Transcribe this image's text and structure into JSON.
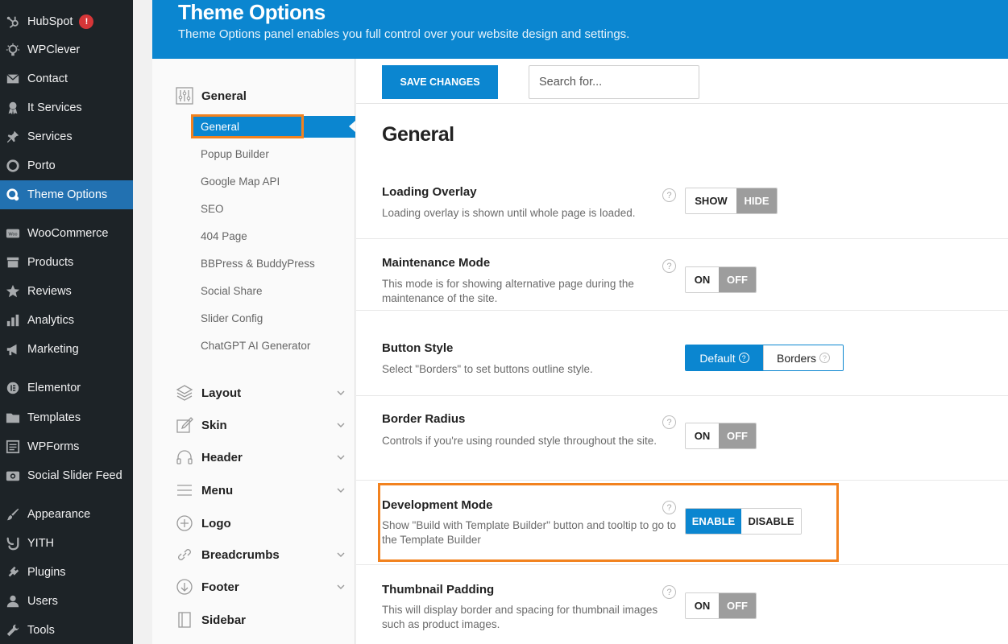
{
  "wp_menu": [
    {
      "label": "HubSpot",
      "icon": "hubspot-icon",
      "badge": "!"
    },
    {
      "label": "WPClever",
      "icon": "wpclever-icon"
    },
    {
      "label": "Contact",
      "icon": "mail-icon"
    },
    {
      "label": "It Services",
      "icon": "award-icon"
    },
    {
      "label": "Services",
      "icon": "pin-icon"
    },
    {
      "label": "Porto",
      "icon": "circle-icon"
    },
    {
      "label": "Theme Options",
      "icon": "theme-options-icon",
      "active": true
    },
    {
      "label": "WooCommerce",
      "icon": "woocommerce-icon"
    },
    {
      "label": "Products",
      "icon": "archive-icon"
    },
    {
      "label": "Reviews",
      "icon": "star-icon"
    },
    {
      "label": "Analytics",
      "icon": "bar-chart-icon"
    },
    {
      "label": "Marketing",
      "icon": "megaphone-icon"
    },
    {
      "label": "Elementor",
      "icon": "elementor-icon"
    },
    {
      "label": "Templates",
      "icon": "folder-icon"
    },
    {
      "label": "WPForms",
      "icon": "form-icon"
    },
    {
      "label": "Social Slider Feed",
      "icon": "instagram-icon"
    },
    {
      "label": "Appearance",
      "icon": "brush-icon"
    },
    {
      "label": "YITH",
      "icon": "yith-icon"
    },
    {
      "label": "Plugins",
      "icon": "plug-icon"
    },
    {
      "label": "Users",
      "icon": "user-icon"
    },
    {
      "label": "Tools",
      "icon": "wrench-icon"
    }
  ],
  "banner": {
    "title": "Theme Options",
    "subtitle": "Theme Options panel enables you full control over your website design and settings."
  },
  "options_nav": {
    "top_label": "General",
    "active_sub": "General",
    "subitems": [
      "Popup Builder",
      "Google Map API",
      "SEO",
      "404 Page",
      "BBPress & BuddyPress",
      "Social Share",
      "Slider Config",
      "ChatGPT AI Generator"
    ],
    "sections": [
      {
        "label": "Layout",
        "icon": "layers-icon",
        "chevron": true
      },
      {
        "label": "Skin",
        "icon": "edit-icon",
        "chevron": true
      },
      {
        "label": "Header",
        "icon": "headphones-icon",
        "chevron": true
      },
      {
        "label": "Menu",
        "icon": "menu-icon",
        "chevron": true
      },
      {
        "label": "Logo",
        "icon": "plus-circle-icon",
        "chevron": false
      },
      {
        "label": "Breadcrumbs",
        "icon": "link-icon",
        "chevron": true
      },
      {
        "label": "Footer",
        "icon": "arrow-down-circle-icon",
        "chevron": true
      },
      {
        "label": "Sidebar",
        "icon": "sidebar-icon",
        "chevron": false
      }
    ]
  },
  "toolbar": {
    "save_label": "SAVE CHANGES",
    "search_placeholder": "Search for..."
  },
  "main": {
    "section_title": "General",
    "options": [
      {
        "title": "Loading Overlay",
        "desc": "Loading overlay is shown until whole page is loaded.",
        "buttons": [
          "SHOW",
          "HIDE"
        ],
        "selected": 1
      },
      {
        "title": "Maintenance Mode",
        "desc": "This mode is for showing alternative page during the maintenance of the site.",
        "buttons": [
          "ON",
          "OFF"
        ],
        "selected": 1
      },
      {
        "title": "Button Style",
        "desc": "Select \"Borders\" to set buttons outline style.",
        "buttons": [
          "Default",
          "Borders"
        ],
        "selected": 0
      },
      {
        "title": "Border Radius",
        "desc": "Controls if you're using rounded style throughout the site.",
        "buttons": [
          "ON",
          "OFF"
        ],
        "selected": 1
      },
      {
        "title": "Development Mode",
        "desc": "Show \"Build with Template Builder\" button and tooltip to go to the Template Builder",
        "buttons": [
          "ENABLE",
          "DISABLE"
        ],
        "selected": 0
      },
      {
        "title": "Thumbnail Padding",
        "desc": "This will display border and spacing for thumbnail images such as product images.",
        "buttons": [
          "ON",
          "OFF"
        ],
        "selected": 1
      }
    ],
    "help_glyph": "?"
  },
  "colors": {
    "accent": "#0b86d0",
    "highlight": "#f2821f",
    "wp_sidebar": "#1d2327",
    "wp_active": "#2271b1"
  }
}
